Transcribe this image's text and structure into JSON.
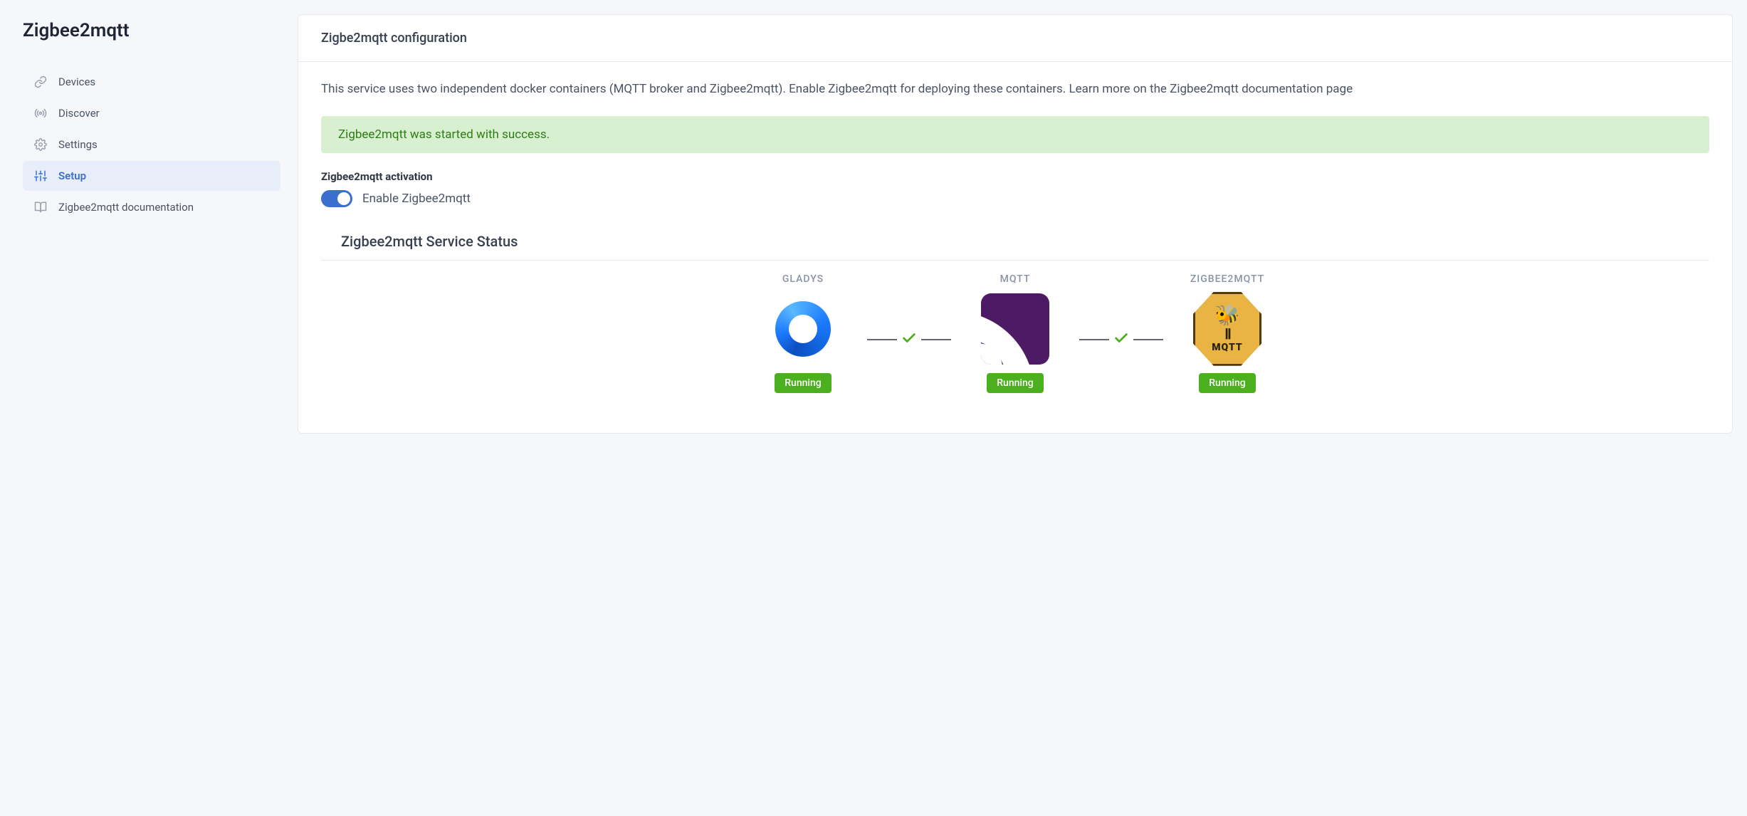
{
  "sidebar": {
    "title": "Zigbee2mqtt",
    "items": [
      {
        "label": "Devices",
        "icon": "link-icon",
        "active": false
      },
      {
        "label": "Discover",
        "icon": "broadcast-icon",
        "active": false
      },
      {
        "label": "Settings",
        "icon": "gear-icon",
        "active": false
      },
      {
        "label": "Setup",
        "icon": "sliders-icon",
        "active": true
      },
      {
        "label": "Zigbee2mqtt documentation",
        "icon": "book-icon",
        "active": false
      }
    ]
  },
  "header": {
    "title": "Zigbe2mqtt configuration"
  },
  "intro": "This service uses two independent docker containers (MQTT broker and Zigbee2mqtt). Enable Zigbee2mqtt for deploying these containers. Learn more on the Zigbee2mqtt documentation page",
  "alert": "Zigbee2mqtt was started with success.",
  "activation": {
    "section_label": "Zigbee2mqtt activation",
    "toggle_label": "Enable Zigbee2mqtt",
    "enabled": true
  },
  "status": {
    "title": "Zigbee2mqtt Service Status",
    "services": [
      {
        "name": "GLADYS",
        "status": "Running",
        "logo": "gladys"
      },
      {
        "name": "MQTT",
        "status": "Running",
        "logo": "mqtt"
      },
      {
        "name": "ZIGBEE2MQTT",
        "status": "Running",
        "logo": "zigbee2mqtt"
      }
    ],
    "connections": [
      {
        "ok": true
      },
      {
        "ok": true
      }
    ]
  }
}
